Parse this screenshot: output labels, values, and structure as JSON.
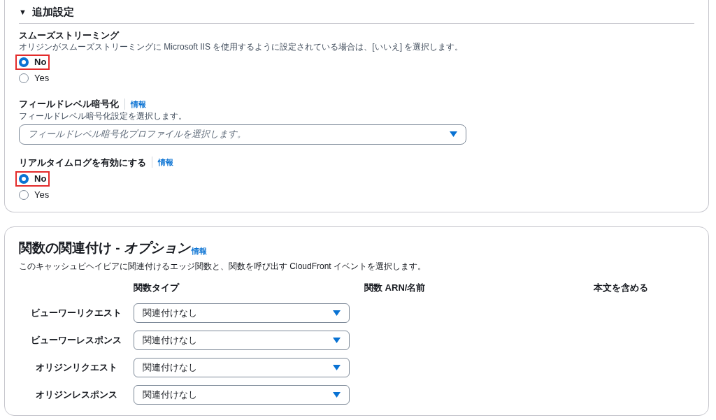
{
  "additional_settings": {
    "toggle": "▼",
    "title": "追加設定",
    "expanded": true,
    "smooth_streaming": {
      "label": "スムーズストリーミング",
      "description": "オリジンがスムーズストリーミングに Microsoft IIS を使用するように設定されている場合は、[いいえ] を選択します。",
      "options": [
        {
          "kind": "outlined",
          "label": "No",
          "selected": true
        },
        {
          "kind": "plain",
          "label": "Yes",
          "selected": false
        }
      ]
    },
    "field_level_encryption": {
      "label": "フィールドレベル暗号化",
      "info": "情報",
      "description": "フィールドレベル暗号化設定を選択します。",
      "placeholder": "フィールドレベル暗号化プロファイルを選択します。"
    },
    "realtime_logs": {
      "label": "リアルタイムログを有効にする",
      "info": "情報",
      "options": [
        {
          "kind": "outlined",
          "label": "No",
          "selected": true
        },
        {
          "kind": "plain",
          "label": "Yes",
          "selected": false
        }
      ]
    }
  },
  "function_associations": {
    "title": "関数の関連付け - *オプション*",
    "info": "情報",
    "description": "このキャッシュビヘイビアに関連付けるエッジ関数と、関数を呼び出す CloudFront イベントを選択します。",
    "columns": [
      "関数タイプ",
      "関数 ARN/名前",
      "本文を含める"
    ],
    "rows": [
      {
        "event": "ビューワーリクエスト",
        "function_type": "関連付けなし"
      },
      {
        "event": "ビューワーレスポンス",
        "function_type": "関連付けなし"
      },
      {
        "event": "オリジンリクエスト",
        "function_type": "関連付けなし"
      },
      {
        "event": "オリジンレスポンス",
        "function_type": "関連付けなし"
      }
    ]
  }
}
